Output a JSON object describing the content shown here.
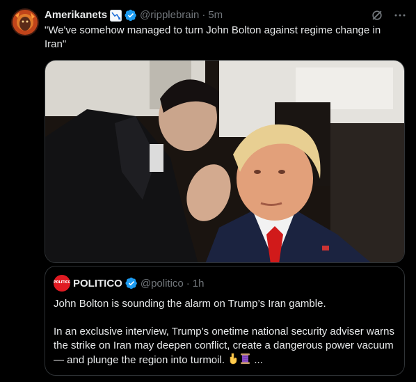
{
  "author": {
    "display_name": "Amerikanets",
    "name_emoji": "chart-decreasing-emoji",
    "verified": true,
    "handle": "@ripplebrain",
    "separator": "·",
    "time": "5m"
  },
  "tweet_text": "\"We've somehow managed to turn John Bolton against regime change in Iran\"",
  "icons": {
    "grok": "grok-icon",
    "more": "more-icon",
    "verified": "verified-badge-icon"
  },
  "quote": {
    "avatar_text": "POLITICO",
    "display_name": "POLITICO",
    "verified": true,
    "handle": "@politico",
    "separator": "·",
    "time": "1h",
    "paragraph1": "John Bolton is sounding the alarm on Trump’s Iran gamble.",
    "paragraph2": "In an exclusive interview, Trump’s onetime national security adviser warns the strike on Iran may deepen conflict, create a dangerous power vacuum — and plunge the region into turmoil. ",
    "ellipsis": "..."
  },
  "colors": {
    "background": "#000000",
    "text": "#e7e9ea",
    "secondary": "#71767b",
    "verified": "#1d9bf0",
    "border": "#2f3336",
    "politico_red": "#e01a22"
  }
}
